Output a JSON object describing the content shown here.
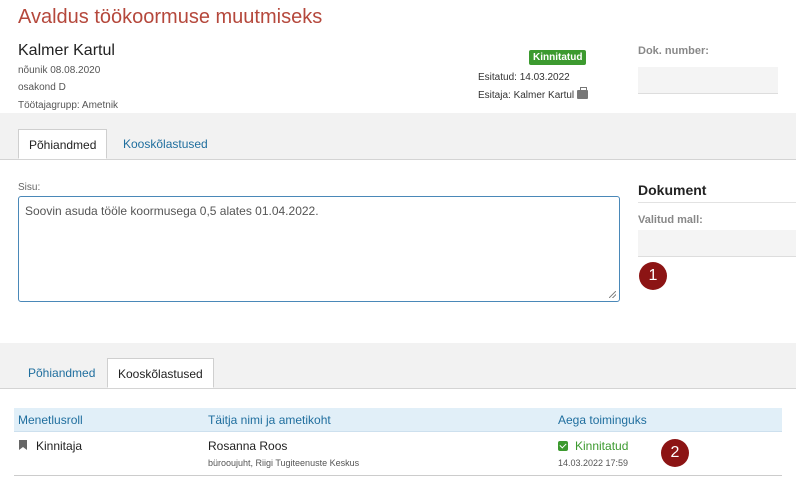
{
  "page": {
    "title": "Avaldus töökoormuse muutmiseks"
  },
  "person": {
    "name": "Kalmer Kartul",
    "position_date": "nõunik 08.08.2020",
    "department": "osakond D",
    "group": "Töötajagrupp: Ametnik"
  },
  "status": {
    "badge": "Kinnitatud",
    "badge_color": "#3c9a2f",
    "submitted": "Esitatud: 14.03.2022",
    "submitter": "Esitaja: Kalmer Kartul"
  },
  "doc_number": {
    "label": "Dok. number:",
    "value": ""
  },
  "tabs_top": [
    {
      "label": "Põhiandmed",
      "active": true
    },
    {
      "label": "Kooskõlastused",
      "active": false
    }
  ],
  "content": {
    "label": "Sisu:",
    "value": "Soovin asuda tööle koormusega 0,5 alates 01.04.2022."
  },
  "document": {
    "title": "Dokument",
    "template_label": "Valitud mall:",
    "template_value": ""
  },
  "markers": [
    "1",
    "2"
  ],
  "tabs_bottom": [
    {
      "label": "Põhiandmed",
      "active": false
    },
    {
      "label": "Kooskõlastused",
      "active": true
    }
  ],
  "table": {
    "headers": [
      "Menetlusroll",
      "Täitja nimi ja ametikoht",
      "Aega toiminguks"
    ],
    "rows": [
      {
        "role": "Kinnitaja",
        "name": "Rosanna Roos",
        "title": "bürooujuht, Riigi Tugiteenuste Keskus",
        "status": "Kinnitatud",
        "date": "14.03.2022 17:59"
      }
    ]
  },
  "colors": {
    "title": "#b5483c",
    "link": "#1f6e9e",
    "marker": "#8c1414",
    "success": "#3c9a2f"
  }
}
